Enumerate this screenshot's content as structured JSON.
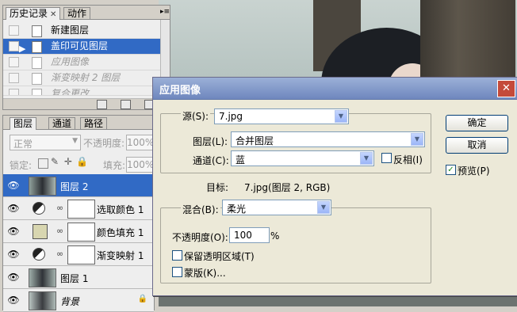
{
  "history_panel": {
    "tabs": [
      {
        "label": "历史记录"
      },
      {
        "label": "动作"
      }
    ],
    "close_glyph": "✕",
    "items": [
      {
        "label": "新建图层",
        "state": "normal"
      },
      {
        "label": "盖印可见图层",
        "state": "selected"
      },
      {
        "label": "应用图像",
        "state": "ghost"
      },
      {
        "label": "渐变映射 2 图层",
        "state": "ghost"
      },
      {
        "label": "复合更改",
        "state": "ghost"
      }
    ]
  },
  "layers_panel": {
    "tabs": [
      {
        "label": "图层"
      },
      {
        "label": "通道"
      },
      {
        "label": "路径"
      }
    ],
    "blend_mode": "正常",
    "opacity_label": "不透明度:",
    "opacity_value": "100%",
    "lock_label": "锁定:",
    "fill_label": "填充:",
    "fill_value": "100%",
    "layers": [
      {
        "name": "图层 2",
        "kind": "photo",
        "selected": true
      },
      {
        "name": "选取颜色 1",
        "kind": "adjustment"
      },
      {
        "name": "颜色填充 1",
        "kind": "fill"
      },
      {
        "name": "渐变映射 1",
        "kind": "adjustment"
      },
      {
        "name": "图层 1",
        "kind": "photo"
      },
      {
        "name": "背景",
        "kind": "background",
        "locked": true
      }
    ],
    "fill_color": "#d8d6b0"
  },
  "dialog": {
    "title": "应用图像",
    "source_label": "源(S):",
    "source_value": "7.jpg",
    "layer_label": "图层(L):",
    "layer_value": "合并图层",
    "channel_label": "通道(C):",
    "channel_value": "蓝",
    "invert_label": "反相(I)",
    "invert_checked": false,
    "target_label": "目标:",
    "target_value": "7.jpg(图层 2, RGB)",
    "blend_label": "混合(B):",
    "blend_value": "柔光",
    "opacity_label": "不透明度(O):",
    "opacity_value": "100",
    "opacity_unit": "%",
    "preserve_label": "保留透明区域(T)",
    "preserve_checked": false,
    "mask_label": "蒙版(K)...",
    "mask_checked": false,
    "ok_label": "确定",
    "cancel_label": "取消",
    "preview_label": "预览(P)",
    "preview_checked": true
  },
  "colors": {
    "selection": "#316ac5",
    "titlebar": "#7f95c6"
  }
}
